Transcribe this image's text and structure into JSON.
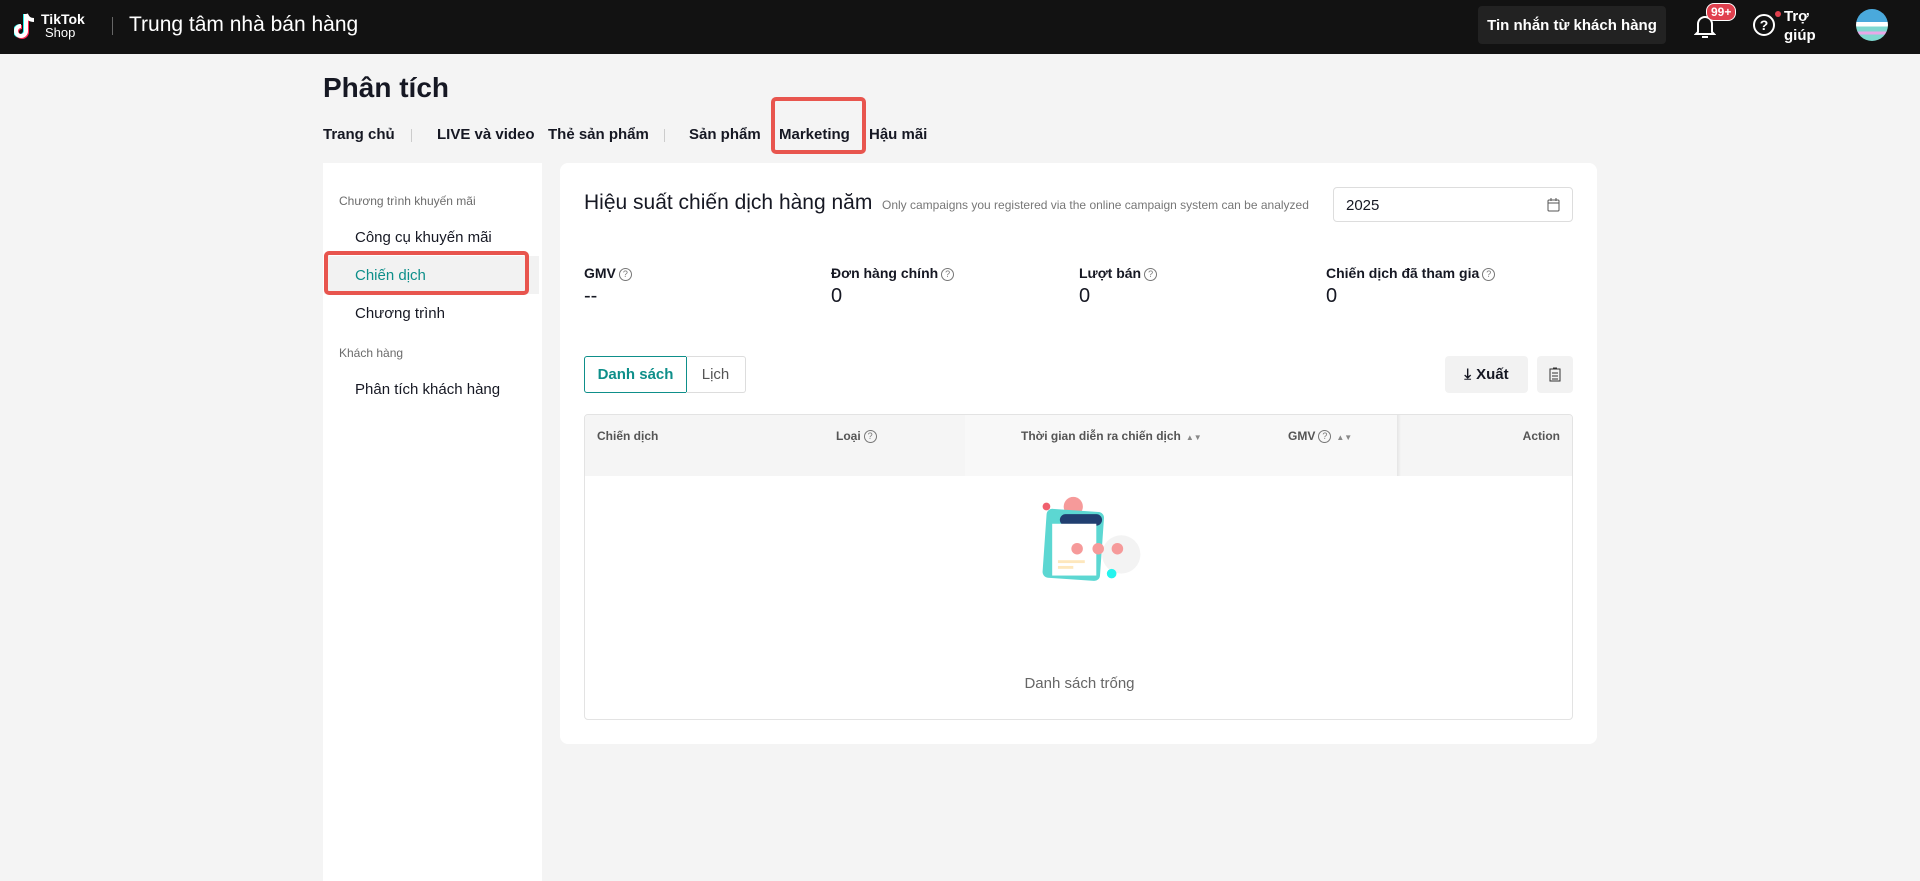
{
  "header": {
    "logo_top": "TikTok",
    "logo_bottom": "Shop",
    "title": "Trung tâm nhà bán hàng",
    "messages_button": "Tin nhắn từ khách hàng",
    "notification_badge": "99+",
    "help_label": "Trợ giúp"
  },
  "page": {
    "title": "Phân tích",
    "tabs": [
      "Trang chủ",
      "LIVE và video",
      "Thẻ sản phẩm",
      "Sản phẩm",
      "Marketing",
      "Hậu mãi"
    ]
  },
  "sidebar": {
    "groups": [
      {
        "label": "Chương trình khuyến mãi",
        "items": [
          "Công cụ khuyến mãi",
          "Chiến dịch",
          "Chương trình"
        ]
      },
      {
        "label": "Khách hàng",
        "items": [
          "Phân tích khách hàng"
        ]
      }
    ]
  },
  "main": {
    "title": "Hiệu suất chiến dịch hàng năm",
    "note": "Only campaigns you registered via the online campaign system can be analyzed",
    "year": "2025",
    "stats": [
      {
        "label": "GMV",
        "value": "--"
      },
      {
        "label": "Đơn hàng chính",
        "value": "0"
      },
      {
        "label": "Lượt bán",
        "value": "0"
      },
      {
        "label": "Chiến dịch đã tham gia",
        "value": "0"
      }
    ],
    "view_toggle": [
      "Danh sách",
      "Lịch"
    ],
    "export_label": "Xuất",
    "table": {
      "columns": [
        "Chiến dịch",
        "Loại",
        "Thời gian diễn ra chiến dịch",
        "GMV",
        "Action"
      ],
      "empty_text": "Danh sách trống"
    }
  },
  "colors": {
    "accent": "#0e8f8a",
    "highlight": "#e8554e"
  }
}
